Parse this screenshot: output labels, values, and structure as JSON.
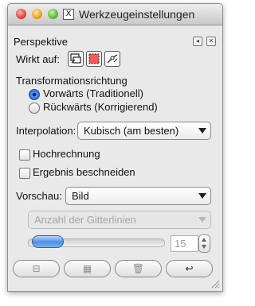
{
  "window": {
    "title": "Werkzeugeinstellungen",
    "x11_glyph": "X"
  },
  "panel": {
    "title": "Perspektive",
    "btn_restore": "◂",
    "btn_close": "✕"
  },
  "affect": {
    "label": "Wirkt auf:",
    "buttons": [
      {
        "name": "layer-icon"
      },
      {
        "name": "selection-icon"
      },
      {
        "name": "path-icon"
      }
    ]
  },
  "direction": {
    "heading": "Transformationsrichtung",
    "options": [
      {
        "label": "Vorwärts (Traditionell)",
        "selected": true
      },
      {
        "label": "Rückwärts (Korrigierend)",
        "selected": false
      }
    ]
  },
  "interpolation": {
    "label": "Interpolation:",
    "value": "Kubisch (am besten)"
  },
  "checks": [
    {
      "label": "Hochrechnung",
      "checked": false
    },
    {
      "label": "Ergebnis beschneiden",
      "checked": false
    }
  ],
  "preview": {
    "label": "Vorschau:",
    "value": "Bild"
  },
  "grid_select": {
    "value": "Anzahl der Gitterlinien",
    "disabled": true
  },
  "grid_count": {
    "value": "15"
  },
  "bottom_buttons": [
    {
      "icon": "⊟",
      "name": "save-options-icon"
    },
    {
      "icon": "▦",
      "name": "restore-options-icon"
    },
    {
      "icon": "🗑",
      "name": "delete-options-icon"
    },
    {
      "icon": "↩",
      "name": "reset-options-icon"
    }
  ]
}
